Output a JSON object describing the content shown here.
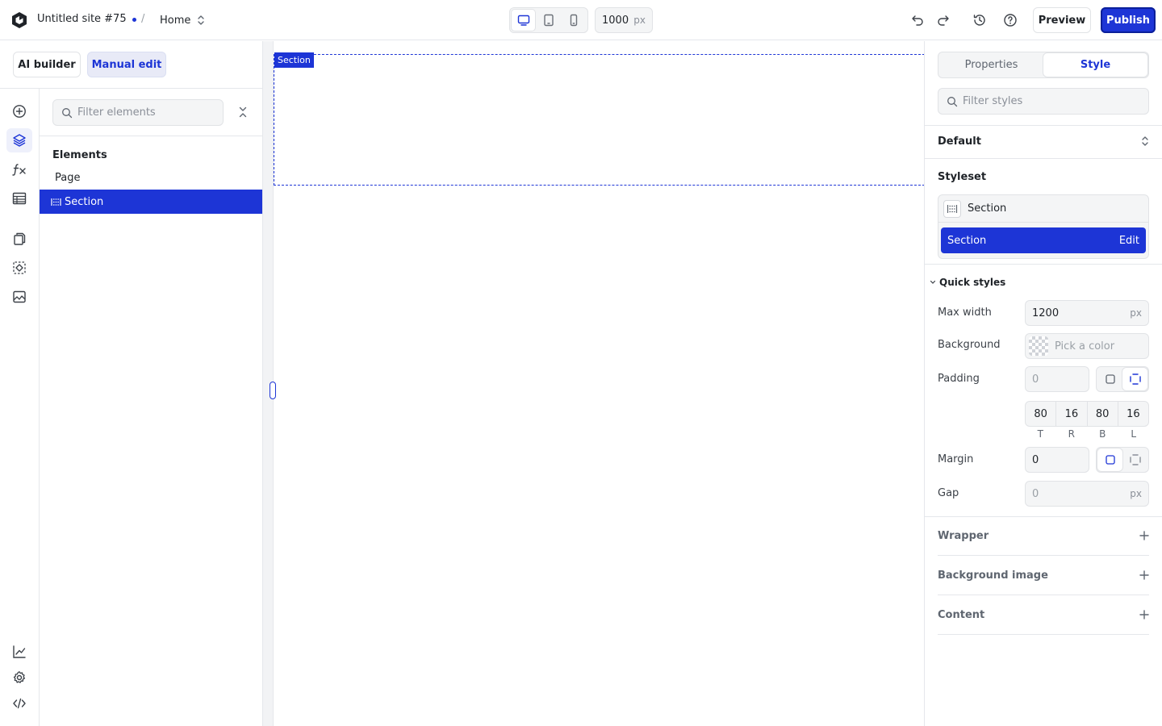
{
  "header": {
    "site_name": "Untitled site #75",
    "separator": "/",
    "page": "Home",
    "canvas_width": "1000",
    "canvas_width_unit": "px",
    "preview_label": "Preview",
    "publish_label": "Publish"
  },
  "mode": {
    "ai_label": "AI builder",
    "manual_label": "Manual edit"
  },
  "elements": {
    "search_placeholder": "Filter elements",
    "heading": "Elements",
    "tree": [
      "Page",
      "Section"
    ]
  },
  "canvas": {
    "section_tag": "Section"
  },
  "right": {
    "tabs": [
      "Properties",
      "Style"
    ],
    "search_placeholder": "Filter styles",
    "state": "Default",
    "styleset_label": "Styleset",
    "styleset_name": "Section",
    "styleset_selected": "Section",
    "edit_label": "Edit",
    "quick_styles": "Quick styles",
    "max_width_label": "Max width",
    "max_width_value": "1200",
    "unit_px": "px",
    "background_label": "Background",
    "background_placeholder": "Pick a color",
    "padding_label": "Padding",
    "padding_all_placeholder": "0",
    "padding": {
      "t": "80",
      "r": "16",
      "b": "80",
      "l": "16"
    },
    "side_labels": [
      "T",
      "R",
      "B",
      "L"
    ],
    "margin_label": "Margin",
    "margin_value": "0",
    "gap_label": "Gap",
    "gap_placeholder": "0",
    "accordions": [
      "Wrapper",
      "Background image",
      "Content"
    ]
  },
  "colors": {
    "accent": "#1d35d6",
    "border": "#e1e3e6",
    "field_bg": "#f4f5f6"
  }
}
